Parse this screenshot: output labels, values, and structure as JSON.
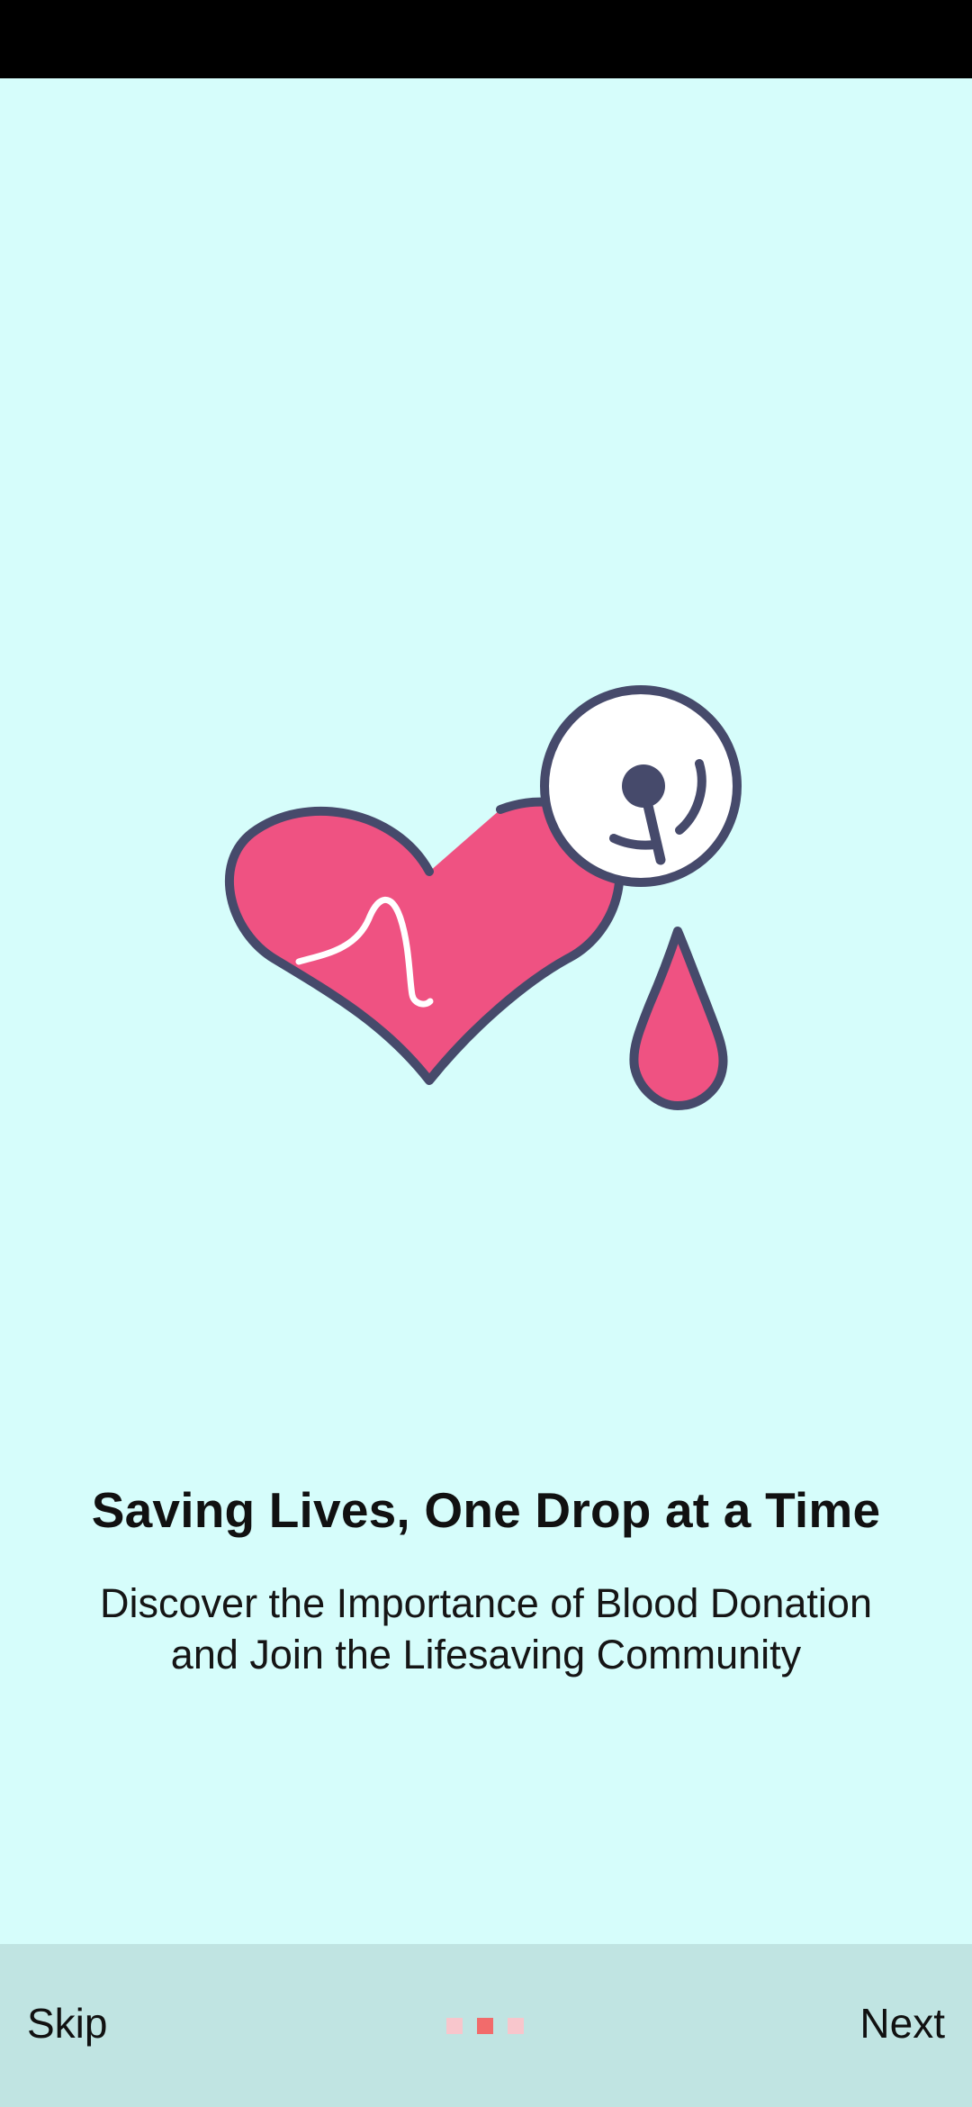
{
  "onboarding": {
    "title": "Saving Lives, One Drop at a Time",
    "subtitle_line1": "Discover the Importance of Blood Donation",
    "subtitle_line2": "and Join the Lifesaving Community",
    "illustration_icon": "heart-stethoscope-blood-drop-icon"
  },
  "navigation": {
    "skip_label": "Skip",
    "next_label": "Next",
    "page_count": 3,
    "active_page": 2
  },
  "colors": {
    "background": "#d6fdfb",
    "bottom_bar": "#c0e4e2",
    "heart": "#ef5282",
    "outline": "#464a6b",
    "dot_active": "#f26b6b",
    "dot_inactive": "#f8c6cc"
  }
}
